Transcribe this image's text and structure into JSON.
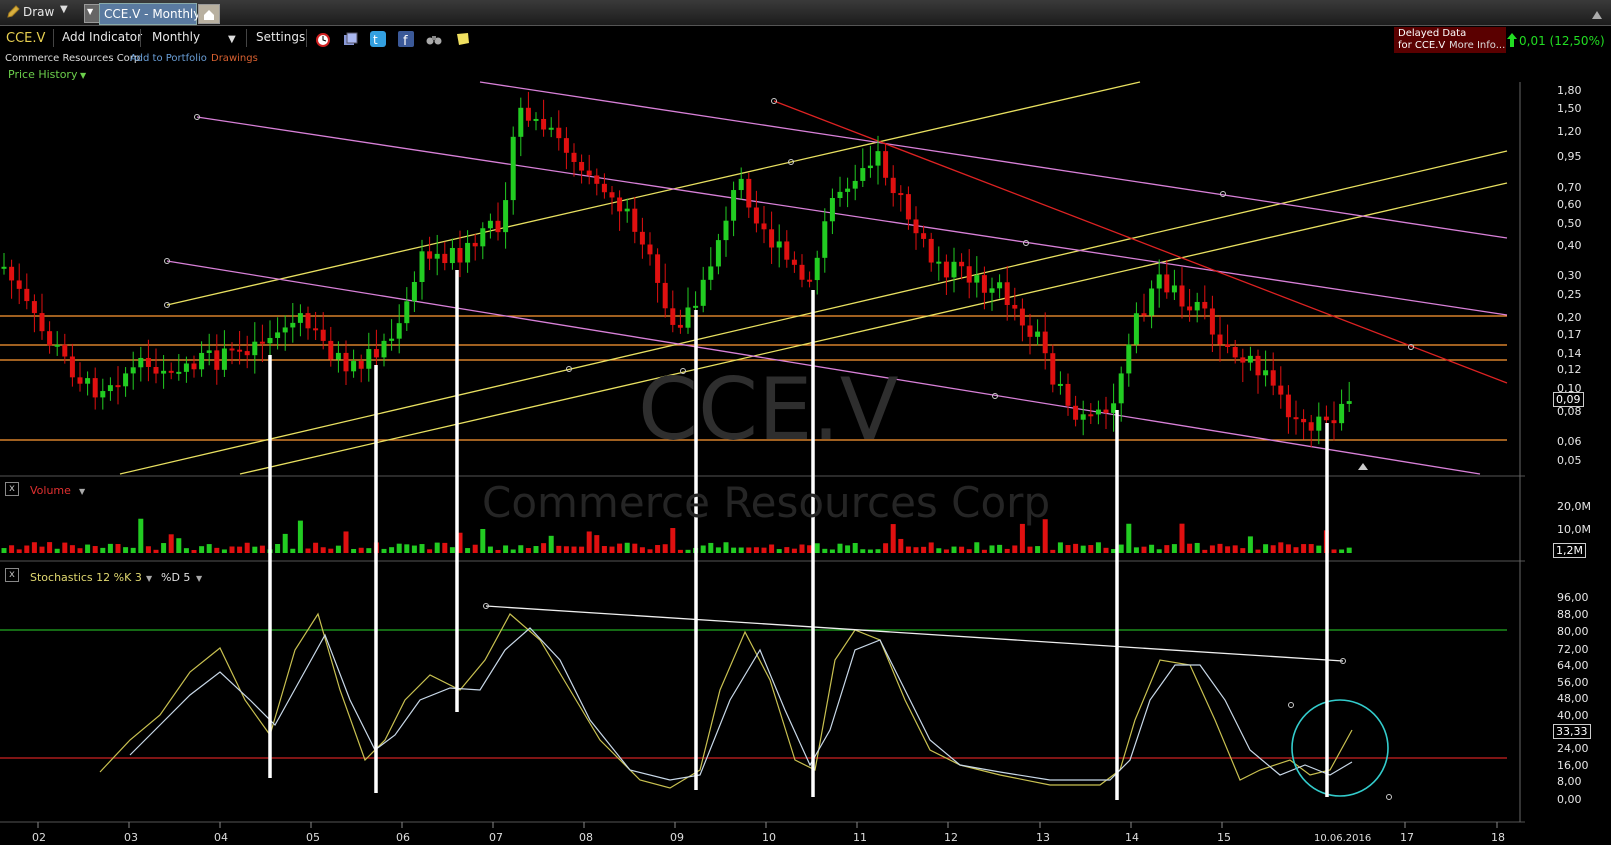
{
  "tabs": {
    "draw_label": "Draw",
    "active_tab": "CCE.V - Monthly"
  },
  "toolbar": {
    "symbol": "CCE.V",
    "add_indicator": "Add Indicator",
    "interval": "Monthly",
    "settings": "Settings",
    "icons": [
      "alarm-icon",
      "layers-icon",
      "twitter-icon",
      "facebook-icon",
      "binoculars-icon",
      "note-icon"
    ]
  },
  "quote": {
    "delayed_line1": "Delayed Data",
    "delayed_line2": "for CCE.V",
    "more_info": "More Info...",
    "change": "0,01 (12,50%)",
    "up_color": "#22dd22"
  },
  "subbar": {
    "company": "Commerce Resources Corp",
    "add_portfolio": "Add to Portfolio",
    "drawings": "Drawings",
    "price_history": "Price History"
  },
  "watermark": {
    "symbol": "CCE.V",
    "company": "Commerce Resources Corp"
  },
  "panels": {
    "volume_label": "Volume",
    "stoch_label": "Stochastics 12 %K 3",
    "stoch_d": "%D 5"
  },
  "axes": {
    "price_ticks": [
      "1,80",
      "1,50",
      "1,20",
      "0,95",
      "0,70",
      "0,60",
      "0,50",
      "0,40",
      "0,30",
      "0,25",
      "0,20",
      "0,17",
      "0,14",
      "0,12",
      "0,10",
      "0,08",
      "0,06",
      "0,05"
    ],
    "volume_ticks": [
      "20,0M",
      "10,0M"
    ],
    "stoch_ticks": [
      "96,00",
      "88,00",
      "80,00",
      "72,00",
      "64,00",
      "56,00",
      "48,00",
      "40,00",
      "32,00",
      "24,00",
      "16,00",
      "8,00",
      "0,00"
    ],
    "x_ticks": [
      "02",
      "03",
      "04",
      "05",
      "06",
      "07",
      "08",
      "09",
      "10",
      "11",
      "12",
      "13",
      "14",
      "15",
      "17",
      "18"
    ],
    "current_date": "10.06.2016"
  },
  "current_values": {
    "price": "0,09",
    "volume": "1,2M",
    "stoch": "33,33"
  },
  "colors": {
    "up": "#22cc22",
    "down": "#e01010",
    "orange": "#ff9933",
    "yellow": "#e8e060",
    "pink": "#d880d8",
    "red_line": "#dd2222",
    "stoch_k": "#c8c050",
    "stoch_d": "#c8d8e8",
    "circle": "#33cccc"
  }
}
